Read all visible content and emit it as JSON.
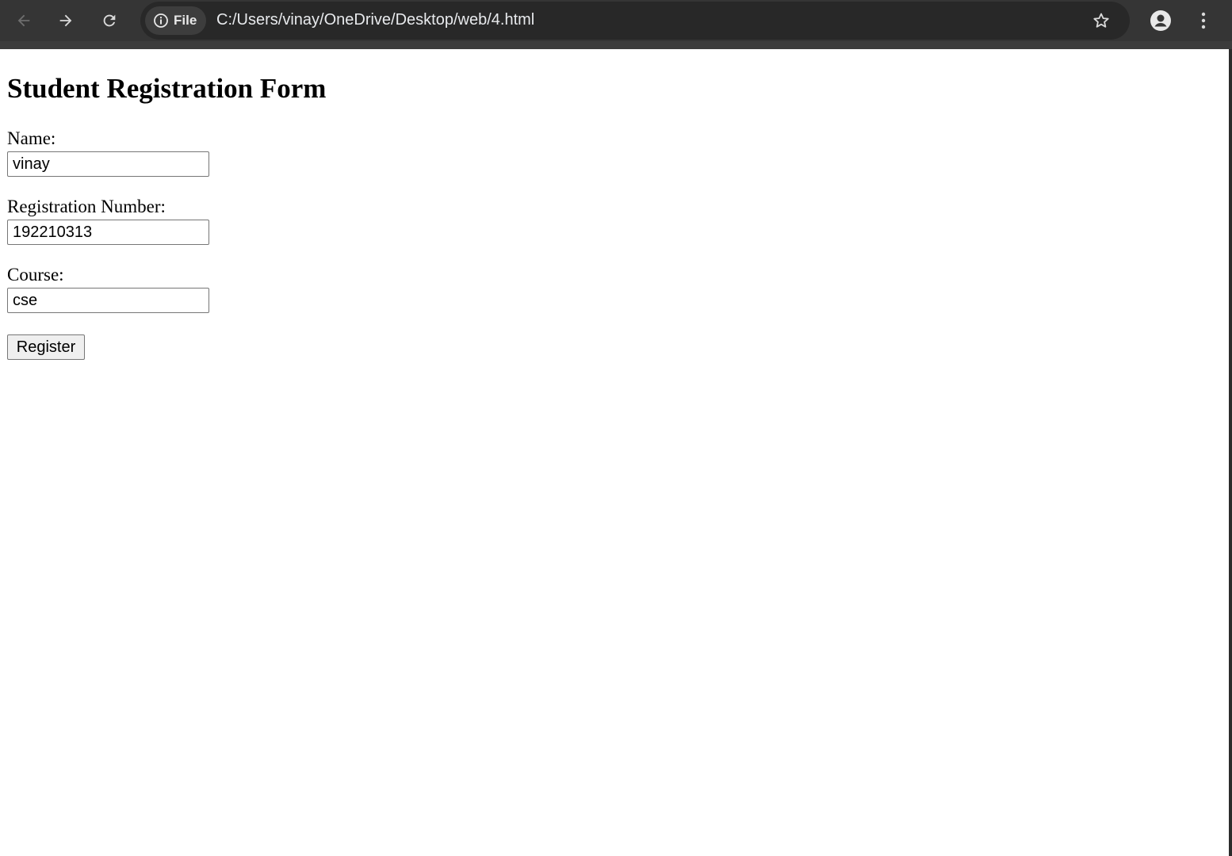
{
  "browser": {
    "site_chip_label": "File",
    "url": "C:/Users/vinay/OneDrive/Desktop/web/4.html",
    "icons": {
      "back": "arrow-left-icon",
      "forward": "arrow-right-icon",
      "reload": "reload-icon",
      "site_info": "info-icon",
      "bookmark": "star-icon",
      "profile": "profile-icon",
      "menu": "kebab-menu-icon"
    },
    "colors": {
      "toolbar": "#353535",
      "omnibox": "#282828",
      "text": "#e8eaed"
    }
  },
  "form": {
    "title": "Student Registration Form",
    "name_label": "Name:",
    "name_value": "vinay",
    "regno_label": "Registration Number:",
    "regno_value": "192210313",
    "course_label": "Course:",
    "course_value": "cse",
    "submit_label": "Register"
  }
}
